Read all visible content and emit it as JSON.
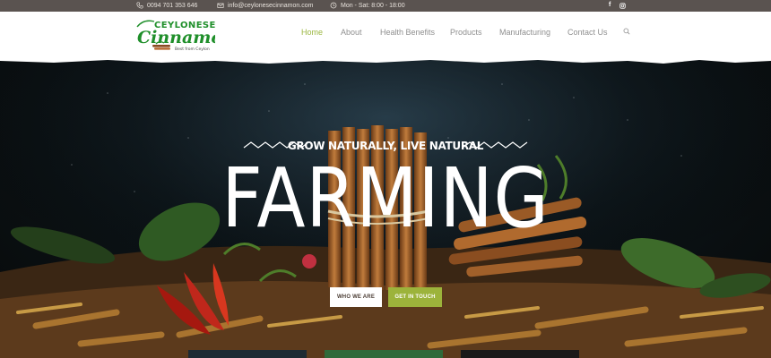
{
  "topbar": {
    "phone": "0094 701 353 646",
    "email": "info@ceylonesecinnamon.com",
    "hours": "Mon - Sat: 8:00 - 18:00"
  },
  "brand": {
    "line1": "CEYLONESE",
    "line2": "Cinnamon",
    "tagline": "Best from Ceylon"
  },
  "nav": {
    "items": [
      "Home",
      "About",
      "Health Benefits",
      "Products",
      "Manufacturing",
      "Contact Us"
    ],
    "active": "Home"
  },
  "hero": {
    "tagline": "GROW NATURALLY, LIVE NATURAL",
    "headline": "FARMING",
    "buttons": {
      "primary": "WHO WE ARE",
      "secondary": "GET IN TOUCH"
    }
  },
  "colors": {
    "accent": "#9bb640",
    "topbar": "#5a5350",
    "button_green": "#9cb33b",
    "logo_green": "#1f8f2a"
  },
  "icons": [
    "phone-icon",
    "mail-icon",
    "clock-icon",
    "facebook-icon",
    "instagram-icon",
    "search-icon"
  ]
}
